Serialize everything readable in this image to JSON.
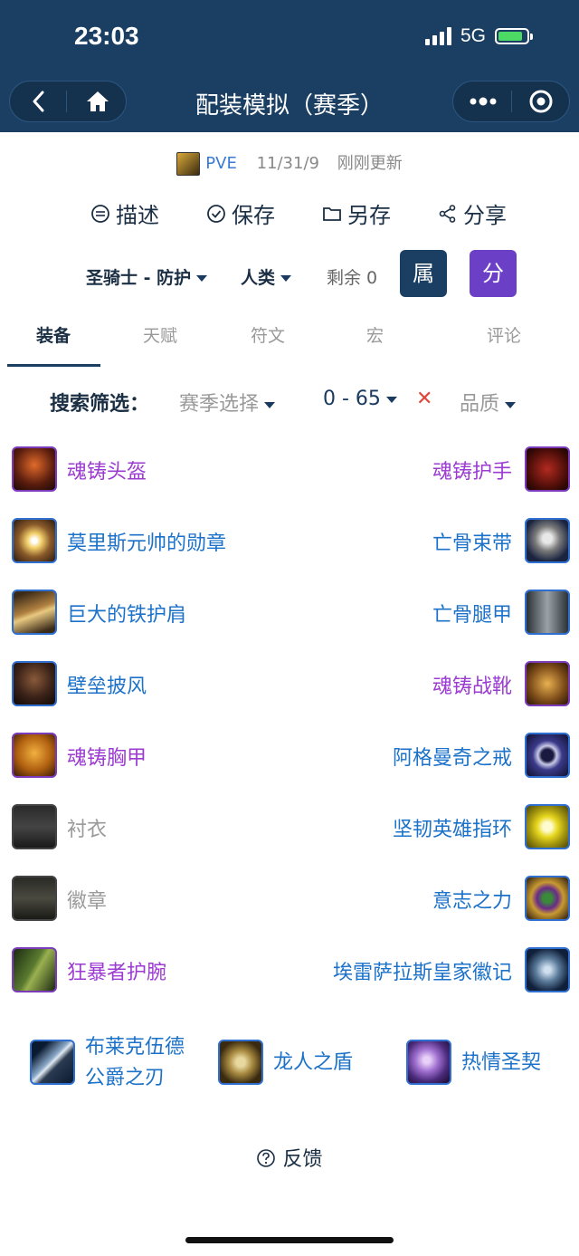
{
  "status": {
    "time": "23:03",
    "network": "5G"
  },
  "nav": {
    "title": "配装模拟（赛季）"
  },
  "info": {
    "mode": "PVE",
    "version": "11/31/9",
    "updated": "刚刚更新"
  },
  "actions": [
    {
      "label": "描述",
      "icon": "describe-icon"
    },
    {
      "label": "保存",
      "icon": "check-icon"
    },
    {
      "label": "另存",
      "icon": "folder-icon"
    },
    {
      "label": "分享",
      "icon": "share-icon"
    }
  ],
  "filters": {
    "class_spec": "圣骑士 - 防护",
    "race": "人类",
    "remaining": "剩余 0",
    "attr_button": "属",
    "score_button": "分"
  },
  "tabs": [
    "装备",
    "天赋",
    "符文",
    "宏",
    "评论"
  ],
  "search": {
    "label": "搜索筛选：",
    "season": "赛季选择",
    "level": "0 - 65",
    "clear": "✕",
    "quality": "品质"
  },
  "equipment": {
    "left": [
      {
        "name": "魂铸头盔",
        "quality": "epic"
      },
      {
        "name": "莫里斯元帅的勋章",
        "quality": "rare"
      },
      {
        "name": "巨大的铁护肩",
        "quality": "rare"
      },
      {
        "name": "壁垒披风",
        "quality": "rare"
      },
      {
        "name": "魂铸胸甲",
        "quality": "epic"
      },
      {
        "name": "衬衣",
        "quality": "common"
      },
      {
        "name": "徽章",
        "quality": "common"
      },
      {
        "name": "狂暴者护腕",
        "quality": "epic"
      }
    ],
    "right": [
      {
        "name": "魂铸护手",
        "quality": "epic"
      },
      {
        "name": "亡骨束带",
        "quality": "rare"
      },
      {
        "name": "亡骨腿甲",
        "quality": "rare"
      },
      {
        "name": "魂铸战靴",
        "quality": "epic"
      },
      {
        "name": "阿格曼奇之戒",
        "quality": "rare"
      },
      {
        "name": "坚韧英雄指环",
        "quality": "rare"
      },
      {
        "name": "意志之力",
        "quality": "rare"
      },
      {
        "name": "埃雷萨拉斯皇家徽记",
        "quality": "rare"
      }
    ]
  },
  "weapons": [
    {
      "name_line1": "布莱克伍德",
      "name_line2": "公爵之刃"
    },
    {
      "name_line1": "龙人之盾",
      "name_line2": ""
    },
    {
      "name_line1": "热情圣契",
      "name_line2": ""
    }
  ],
  "feedback": "反馈",
  "colors": {
    "header": "#1b3f63",
    "epic": "#9b3bd1",
    "rare": "#1c72c9",
    "common": "#9a9a9a",
    "score_button": "#6c3fc7"
  }
}
